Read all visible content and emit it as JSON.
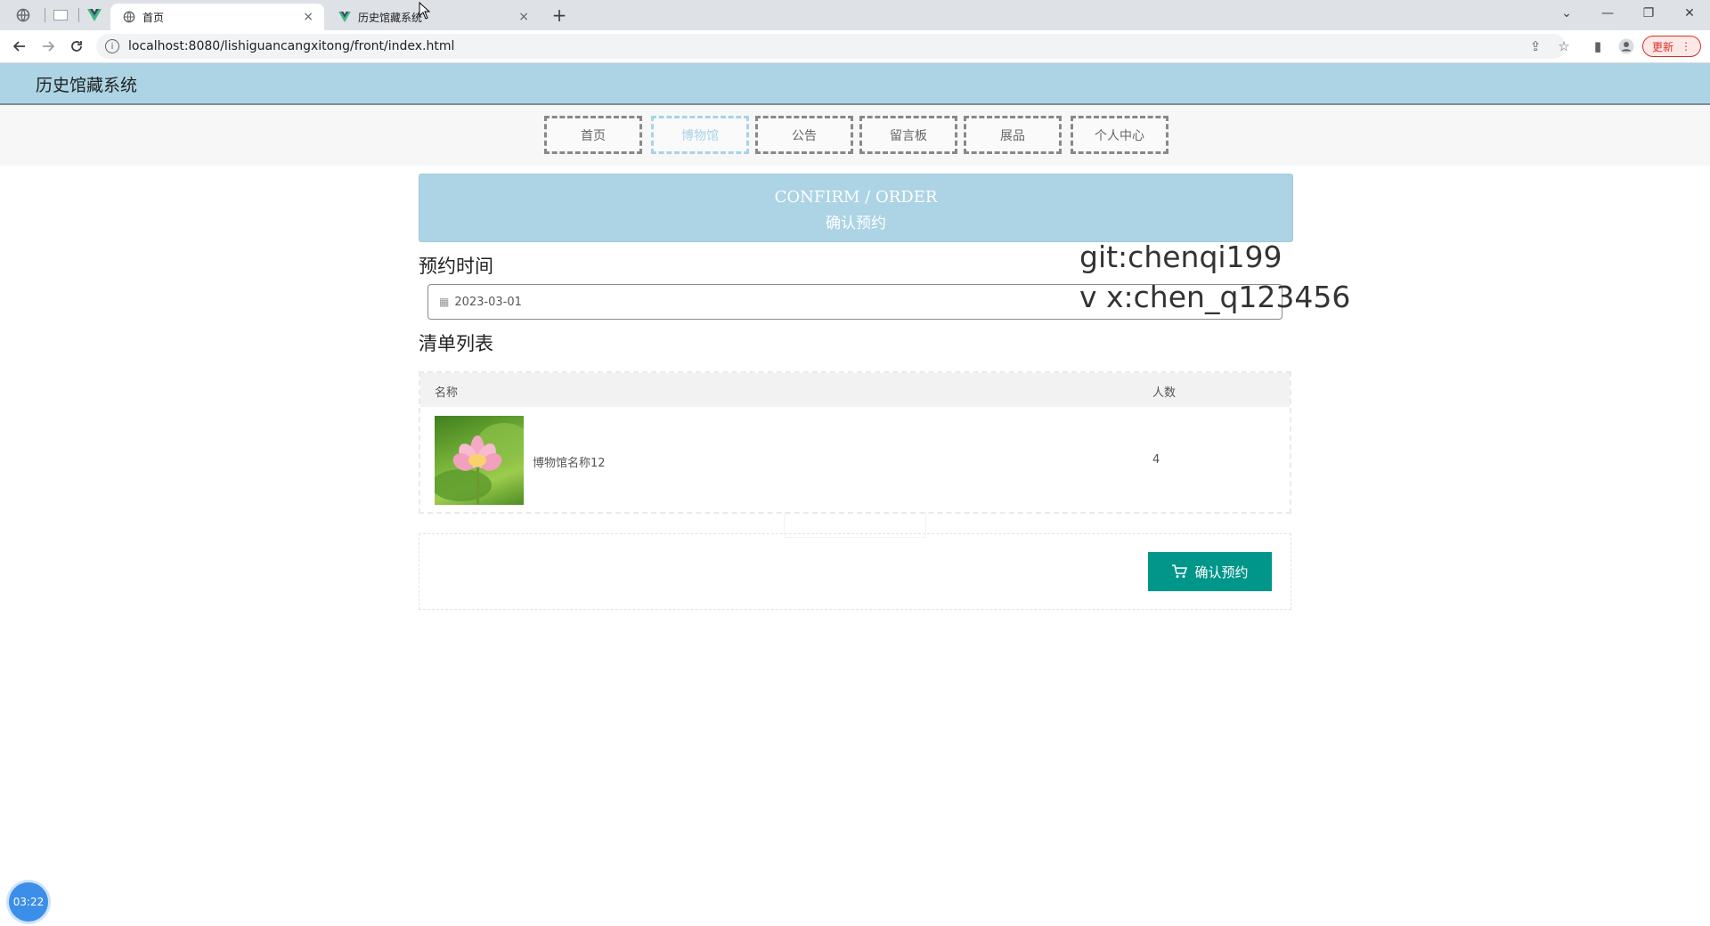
{
  "browser": {
    "tabs": [
      {
        "title": "首页",
        "close": "×"
      },
      {
        "title": "历史馆藏系统",
        "close": "×"
      }
    ],
    "new_tab": "+",
    "window_controls": [
      "⌄",
      "—",
      "❐",
      "✕"
    ],
    "url": "localhost:8080/lishiguancangxitong/front/index.html",
    "update_label": "更新",
    "icons": {
      "back": "arrow-left-icon",
      "forward": "arrow-right-icon",
      "reload": "reload-icon",
      "info": "info-icon",
      "share": "share-icon",
      "bookmark": "star-icon",
      "sidepanel": "side-panel-icon",
      "profile": "profile-icon",
      "menu": "kebab-menu-icon"
    }
  },
  "site": {
    "title": "历史馆藏系统",
    "nav": [
      "首页",
      "博物馆",
      "公告",
      "留言板",
      "展品",
      "个人中心"
    ],
    "active_nav": "博物馆"
  },
  "banner": {
    "en": "CONFIRM / ORDER",
    "cn": "确认预约"
  },
  "booking": {
    "time_label": "预约时间",
    "date_value": "2023-03-01",
    "list_label": "清单列表"
  },
  "table": {
    "headers": [
      "名称",
      "人数"
    ],
    "rows": [
      {
        "name": "博物馆名称12",
        "count": "4"
      }
    ]
  },
  "confirm_button": "确认预约",
  "watermark": {
    "line1": "git:chenqi199",
    "line2": "v x:chen_q123456"
  },
  "timer": "03:22",
  "colors": {
    "header_bg": "#acd4e4",
    "accent": "#00968a",
    "nav_active": "#a8d4e6"
  }
}
